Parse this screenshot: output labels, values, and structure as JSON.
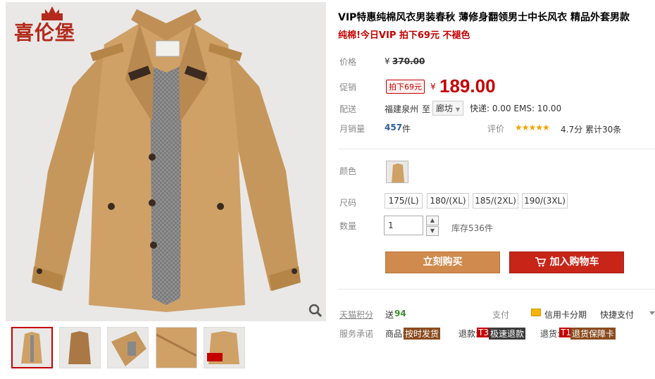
{
  "brand": {
    "logo_text": "喜伦堡"
  },
  "gallery": {
    "thumb_count": 5
  },
  "product": {
    "title": "VIP特惠纯棉风衣男装春秋 薄修身翻领男士中长风衣 精品外套男款",
    "subtitle": "纯棉!今日VIP 拍下69元 不褪色"
  },
  "price": {
    "label": "价格",
    "currency": "¥",
    "original": "370.00"
  },
  "promo": {
    "label": "促销",
    "tag": "拍下69元",
    "currency": "¥",
    "price": "189.00"
  },
  "shipping": {
    "label": "配送",
    "from": "福建泉州",
    "to_word": "至",
    "destination": "廊坊",
    "fees": "快递: 0.00 EMS: 10.00"
  },
  "sales": {
    "label": "月销量",
    "count": "457",
    "unit": "件",
    "rating_label": "评价",
    "stars": "★★★★★",
    "score": "4.7分",
    "total": "累计30条"
  },
  "color": {
    "label": "颜色"
  },
  "size": {
    "label": "尺码",
    "options": [
      "175/(L)",
      "180/(XL)",
      "185/(2XL)",
      "190/(3XL)"
    ]
  },
  "quantity": {
    "label": "数量",
    "value": "1",
    "stock": "库存536件"
  },
  "actions": {
    "buy_now": "立刻购买",
    "add_to_cart": "加入购物车"
  },
  "points": {
    "label": "天猫积分",
    "text": "送",
    "value": "94"
  },
  "payment": {
    "label": "支付",
    "credit": "信用卡分期",
    "express": "快捷支付"
  },
  "service": {
    "label": "服务承诺",
    "goods_label": "商品:",
    "goods_badge": "按时发货",
    "refund_label": "退款:",
    "refund_code": "T3",
    "refund_badge": "极速退款",
    "return_label": "退货:",
    "return_code": "T1",
    "return_badge": "退货保障卡"
  },
  "colors": {
    "accent": "#c40000",
    "buy": "#d08a4e",
    "cart": "#c82519",
    "coat": "#c7995f"
  }
}
